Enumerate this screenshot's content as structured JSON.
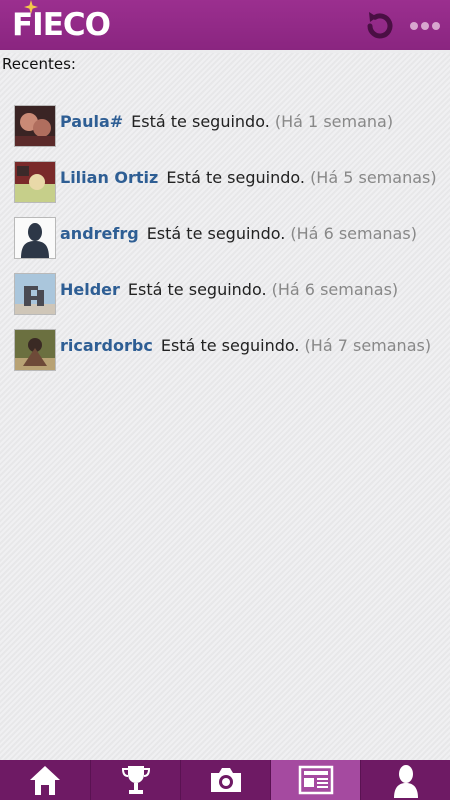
{
  "header": {
    "logo_text": "FIECO",
    "refresh_icon": "refresh-icon",
    "menu_icon": "overflow-menu-icon"
  },
  "main": {
    "section_label": "Recentes:",
    "items": [
      {
        "username": "Paula#",
        "action": "Está te seguindo.",
        "time": "(Há 1 semana)",
        "avatar": "photo-avatar"
      },
      {
        "username": "Lilian Ortiz",
        "action": "Está te seguindo.",
        "time": "(Há 5 semanas)",
        "avatar": "photo-avatar"
      },
      {
        "username": "andrefrg",
        "action": "Está te seguindo.",
        "time": "(Há 6 semanas)",
        "avatar": "default-user-avatar"
      },
      {
        "username": "Helder",
        "action": "Está te seguindo.",
        "time": "(Há 6 semanas)",
        "avatar": "photo-avatar"
      },
      {
        "username": "ricardorbc",
        "action": "Está te seguindo.",
        "time": "(Há 7 semanas)",
        "avatar": "photo-avatar"
      }
    ]
  },
  "bottom_nav": {
    "tabs": [
      {
        "icon": "home-icon",
        "active": false
      },
      {
        "icon": "trophy-icon",
        "active": false
      },
      {
        "icon": "camera-icon",
        "active": false
      },
      {
        "icon": "news-feed-icon",
        "active": true
      },
      {
        "icon": "profile-icon",
        "active": false
      }
    ]
  },
  "colors": {
    "header": "#9b2f8f",
    "bottom_bar": "#6e1a64",
    "active_tab": "#a54aa0",
    "username": "#2e5e94"
  }
}
